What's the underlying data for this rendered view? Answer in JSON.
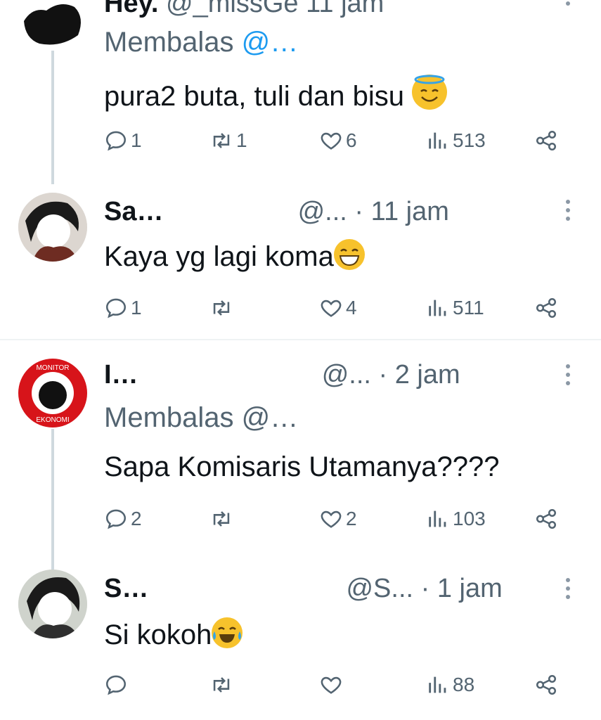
{
  "tweets": [
    {
      "name": "Hey.",
      "handle": "@_missGe",
      "time": "11 jam",
      "reply_label": "Membalas",
      "reply_handle": "@…",
      "text": "pura2 buta, tuli dan bisu",
      "emoji": "smiling-face-with-halo",
      "reply_count": "1",
      "repost_count": "1",
      "like_count": "6",
      "views": "513"
    },
    {
      "name": "Sa…",
      "handle": "@...",
      "time": "· 11 jam",
      "text": "Kaya yg lagi koma",
      "emoji": "grinning-face-with-smiling-eyes",
      "reply_count": "1",
      "repost_count": "",
      "like_count": "4",
      "views": "511"
    },
    {
      "name": "I…",
      "handle": "@...",
      "time": "· 2 jam",
      "reply_label": "Membalas",
      "reply_handle": "@…",
      "text": "Sapa Komisaris Utamanya????",
      "reply_count": "2",
      "repost_count": "",
      "like_count": "2",
      "views": "103"
    },
    {
      "name": "S…",
      "handle": "@S...",
      "time": "· 1 jam",
      "text": "Si kokoh",
      "emoji": "face-with-tears-of-joy",
      "reply_count": "",
      "repost_count": "",
      "like_count": "",
      "views": "88"
    }
  ],
  "colors": {
    "text": "#0f1419",
    "muted": "#536471",
    "line": "#cfd9de",
    "monitor_red": "#d7141a"
  }
}
